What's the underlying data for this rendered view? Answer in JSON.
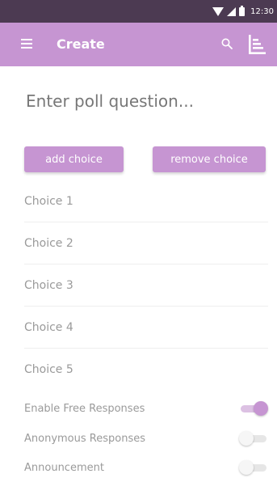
{
  "status_bar": {
    "time": "12:30"
  },
  "toolbar": {
    "title": "Create"
  },
  "question": {
    "placeholder": "Enter poll question..."
  },
  "buttons": {
    "add_label": "add choice",
    "remove_label": "remove choice"
  },
  "choices": [
    {
      "placeholder": "Choice 1"
    },
    {
      "placeholder": "Choice 2"
    },
    {
      "placeholder": "Choice 3"
    },
    {
      "placeholder": "Choice 4"
    },
    {
      "placeholder": "Choice 5"
    }
  ],
  "toggles": [
    {
      "label": "Enable Free Responses",
      "on": true
    },
    {
      "label": "Anonymous Responses",
      "on": false
    },
    {
      "label": "Announcement",
      "on": false
    }
  ],
  "colors": {
    "status_bar": "#4c3a52",
    "accent": "#c695d2",
    "text_hint": "#9a9a9a"
  },
  "icons": [
    "wifi-icon",
    "signal-icon",
    "battery-icon",
    "menu-icon",
    "search-icon",
    "sort-icon"
  ]
}
